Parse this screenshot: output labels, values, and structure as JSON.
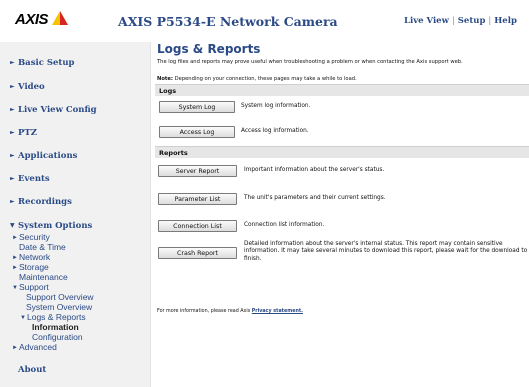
{
  "header": {
    "logo_text": "AXIS",
    "title": "AXIS P5534-E Network Camera",
    "links": [
      "Live View",
      "Setup",
      "Help"
    ],
    "separator": "|"
  },
  "sidebar": {
    "items": [
      {
        "label": "Basic Setup"
      },
      {
        "label": "Video"
      },
      {
        "label": "Live View Config"
      },
      {
        "label": "PTZ"
      },
      {
        "label": "Applications"
      },
      {
        "label": "Events"
      },
      {
        "label": "Recordings"
      },
      {
        "label": "System Options"
      }
    ],
    "system_options": {
      "security": "Security",
      "date_time": "Date & Time",
      "network": "Network",
      "storage": "Storage",
      "maintenance": "Maintenance",
      "support": "Support",
      "support_overview": "Support Overview",
      "system_overview": "System Overview",
      "logs_reports": "Logs & Reports",
      "information": "Information",
      "configuration": "Configuration",
      "advanced": "Advanced"
    },
    "about": "About"
  },
  "main": {
    "title": "Logs & Reports",
    "intro": "The log files and reports may prove useful when troubleshooting a problem or when contacting the Axis support web.",
    "note_label": "Note:",
    "note_text": " Depending on your connection, these pages may take a while to load.",
    "logs_heading": "Logs",
    "reports_heading": "Reports",
    "logs": [
      {
        "button": "System Log",
        "desc": "System log information."
      },
      {
        "button": "Access Log",
        "desc": "Access log information."
      }
    ],
    "reports": [
      {
        "button": "Server Report",
        "desc": "Important information about the server's status."
      },
      {
        "button": "Parameter List",
        "desc": "The unit's parameters and their current settings."
      },
      {
        "button": "Connection List",
        "desc": "Connection list information."
      },
      {
        "button": "Crash Report",
        "desc": "Detailed information about the server's internal status. This report may contain sensitive information. It may take several minutes to download this report, please wait for the download to finish."
      }
    ],
    "footer_text": "For more information, please read Axis ",
    "footer_link": "Privacy statement."
  },
  "colors": {
    "link_blue": "#2a4a86",
    "sidebar_bg": "#f1f1f1",
    "band_bg": "#e6e6e6",
    "logo_yellow": "#f5c400",
    "logo_red": "#d7261f"
  }
}
